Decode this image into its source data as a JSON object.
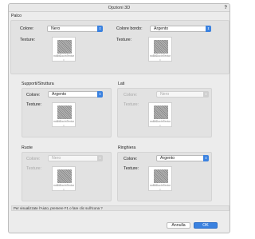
{
  "window": {
    "title": "Opzioni 3D",
    "help": "?"
  },
  "labels": {
    "colore": "Colore:",
    "colore_bordo": "Colore bordo:",
    "texture": "Texture:"
  },
  "texture": {
    "name": "noBitDocInTextur",
    "dot": "•"
  },
  "chevron": "⇕",
  "sections": {
    "pavimento": {
      "title": "Palco",
      "colore": "Nero",
      "colore_bordo": "Argento"
    },
    "supporti": {
      "title": "Supporti/Struttura",
      "colore": "Argento"
    },
    "lati": {
      "title": "Lati",
      "colore": "Nero"
    },
    "ruote": {
      "title": "Ruote",
      "colore": "Nero"
    },
    "ringhiera": {
      "title": "Ringhiera",
      "colore": "Argento"
    }
  },
  "hint": "Per visualizzate l'Aiuto, premere F1 o fare clic sull'icona ?",
  "buttons": {
    "cancel": "Annulla",
    "ok": "OK"
  },
  "colors": {
    "accent": "#3b82e0",
    "disabled_text": "#a8a8a8"
  }
}
